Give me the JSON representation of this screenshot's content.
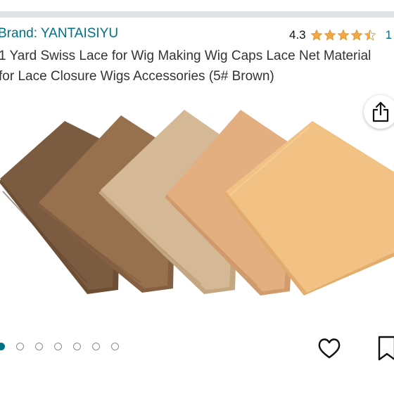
{
  "header": {
    "brand": "Brand: YANTAISIYU",
    "rating_value": "4.3",
    "rating_stars": 4.3,
    "rating_count": "1"
  },
  "product": {
    "title_line_1": "1 Yard Swiss Lace for Wig Making Wig Caps Lace Net Material",
    "title_line_2": "for Lace Closure Wigs Accessories (5# Brown)"
  },
  "icons": {
    "share": "share-icon",
    "heart": "heart-icon",
    "bookmark": "bookmark-icon",
    "star": "star-icon"
  },
  "carousel": {
    "total": 7,
    "active_index": 0
  },
  "colors": {
    "link": "#007185",
    "star": "#f3a847",
    "swatch_1": "#7c5c40",
    "swatch_2": "#97714e",
    "swatch_3": "#d5b996",
    "swatch_4": "#e3ae80",
    "swatch_5": "#f2c284"
  }
}
